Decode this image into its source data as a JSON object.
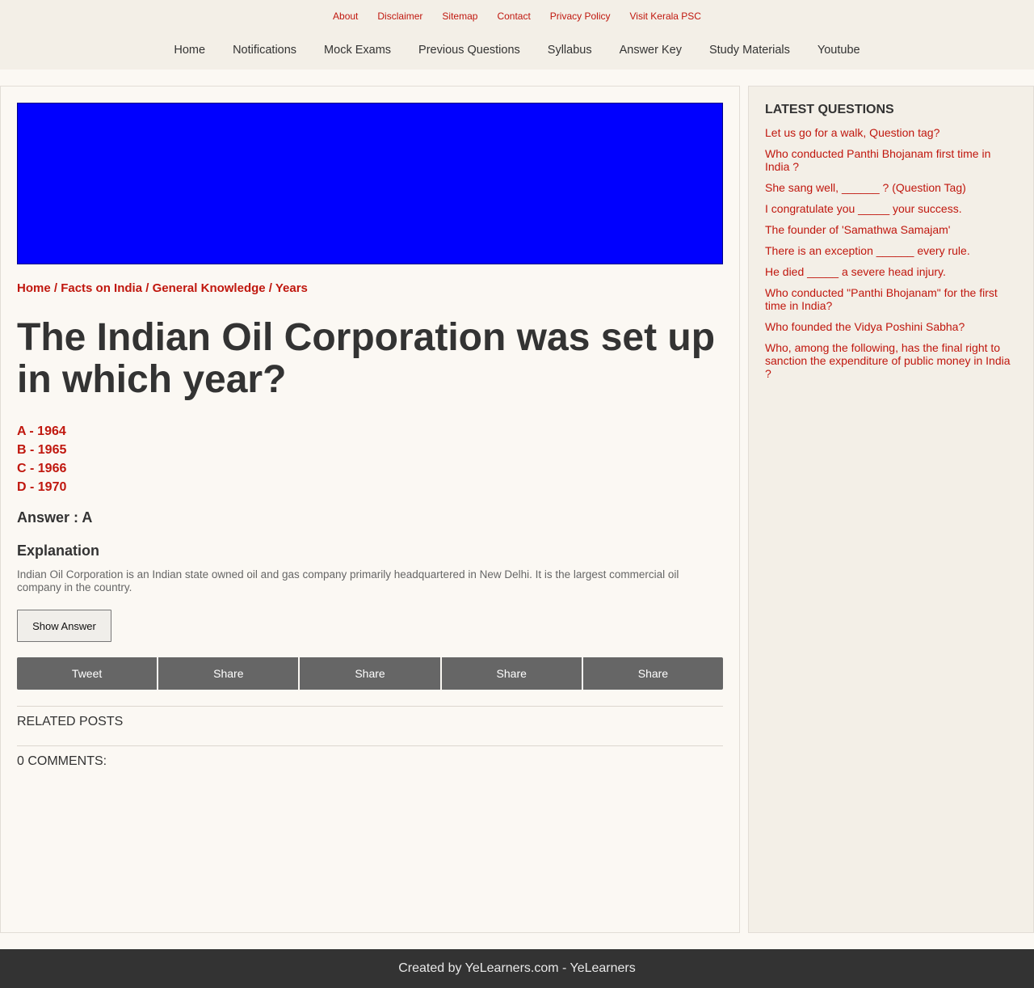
{
  "top_links": [
    "About",
    "Disclaimer",
    "Sitemap",
    "Contact",
    "Privacy Policy",
    "Visit Kerala PSC"
  ],
  "main_nav": [
    "Home",
    "Notifications",
    "Mock Exams",
    "Previous Questions",
    "Syllabus",
    "Answer Key",
    "Study Materials",
    "Youtube"
  ],
  "breadcrumb": [
    "Home",
    "Facts on India",
    "General Knowledge",
    "Years"
  ],
  "breadcrumb_separator": " / ",
  "question": {
    "title": "The Indian Oil Corporation was set up in which year?",
    "options": [
      "A - 1964",
      "B - 1965",
      "C - 1966",
      "D - 1970"
    ],
    "answer": "Answer : A",
    "explanation_heading": "Explanation",
    "explanation": "Indian Oil Corporation is an Indian state owned oil and gas company primarily headquartered in New Delhi. It is the largest commercial oil company in the country.",
    "show_answer_label": "Show Answer"
  },
  "share_buttons": [
    "Tweet",
    "Share",
    "Share",
    "Share",
    "Share"
  ],
  "related_posts_label": "RELATED POSTS",
  "comments_label": "0 COMMENTS:",
  "sidebar": {
    "heading": "LATEST QUESTIONS",
    "items": [
      "Let us go for a walk, Question tag?",
      "Who conducted Panthi Bhojanam first time in India ?",
      "She sang well, ______ ? (Question Tag)",
      "I congratulate you _____ your success.",
      "The founder of 'Samathwa Samajam'",
      "There is an exception ______ every rule.",
      "He died _____ a severe head injury.",
      "Who conducted \"Panthi Bhojanam\" for the first time in India?",
      "Who founded the Vidya Poshini Sabha?",
      "Who, among the following, has the final right to sanction the expenditure of public money in India ?"
    ]
  },
  "footer": "Created by YeLearners.com - YeLearners",
  "colors": {
    "accent": "#c0170e",
    "ad_banner": "#0000ff",
    "share_bar": "#666666",
    "footer_bg": "#333333"
  }
}
